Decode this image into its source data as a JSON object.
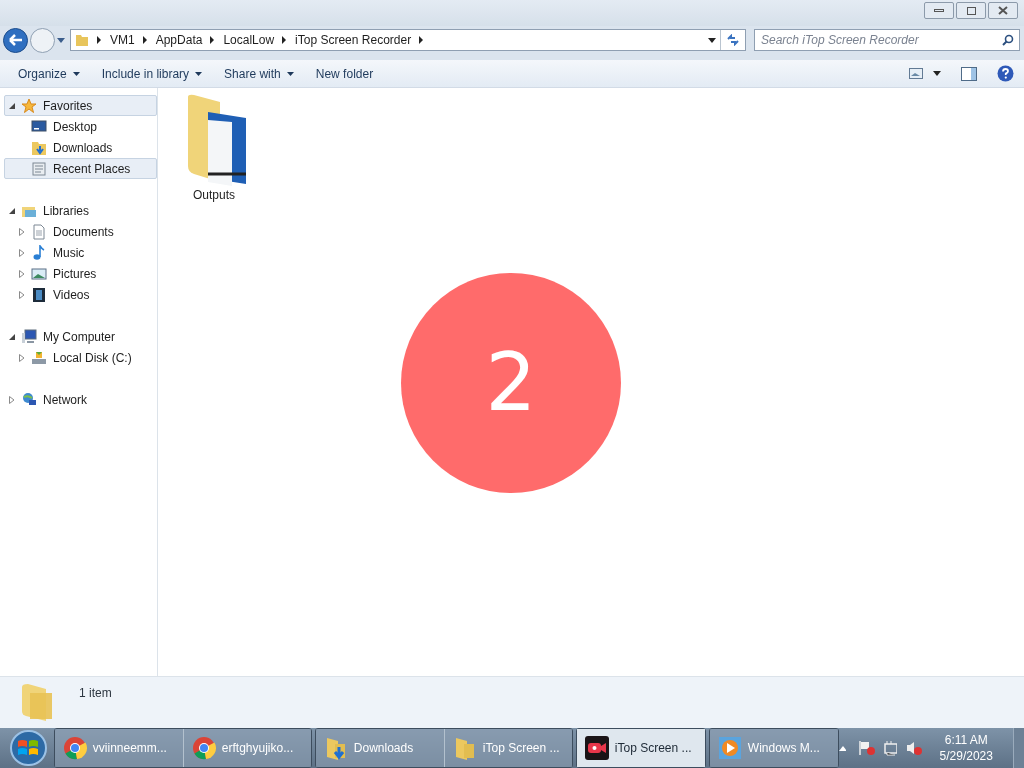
{
  "address": {
    "crumbs": [
      "VM1",
      "AppData",
      "LocalLow",
      "iTop Screen Recorder"
    ]
  },
  "search": {
    "placeholder": "Search iTop Screen Recorder"
  },
  "toolbar": {
    "menus": [
      {
        "label": "Organize",
        "dropdown": true
      },
      {
        "label": "Include in library",
        "dropdown": true
      },
      {
        "label": "Share with",
        "dropdown": true
      },
      {
        "label": "New folder",
        "dropdown": false
      }
    ]
  },
  "sidebar": {
    "groups": [
      {
        "label": "Favorites",
        "kind": "star",
        "expanded": true,
        "highlighted": true,
        "children": [
          {
            "label": "Desktop",
            "kind": "desktop",
            "highlighted": false
          },
          {
            "label": "Downloads",
            "kind": "downloads",
            "highlighted": false
          },
          {
            "label": "Recent Places",
            "kind": "recent",
            "highlighted": true
          }
        ]
      },
      {
        "label": "Libraries",
        "kind": "library",
        "expanded": true,
        "highlighted": false,
        "children": [
          {
            "label": "Documents",
            "kind": "documents",
            "expanded": false,
            "highlighted": false
          },
          {
            "label": "Music",
            "kind": "music",
            "expanded": false,
            "highlighted": false
          },
          {
            "label": "Pictures",
            "kind": "pictures",
            "expanded": false,
            "highlighted": false
          },
          {
            "label": "Videos",
            "kind": "videos",
            "expanded": false,
            "highlighted": false
          }
        ]
      },
      {
        "label": "My Computer",
        "kind": "computer",
        "expanded": true,
        "highlighted": false,
        "children": [
          {
            "label": "Local Disk (C:)",
            "kind": "disk",
            "expanded": false,
            "highlighted": false
          }
        ]
      },
      {
        "label": "Network",
        "kind": "network",
        "expanded": false,
        "highlighted": false
      }
    ]
  },
  "files": [
    {
      "name": "Outputs"
    }
  ],
  "countdown": "2",
  "status_bar": {
    "text": "1 item"
  },
  "taskbar": {
    "groups": [
      [
        {
          "label": "vviinneemm...",
          "kind": "chrome",
          "selected": false
        },
        {
          "label": "erftghyujiko...",
          "kind": "chrome",
          "selected": false
        }
      ],
      [
        {
          "label": "Downloads",
          "kind": "downloads",
          "selected": false
        },
        {
          "label": "iTop Screen ...",
          "kind": "folder",
          "selected": false
        }
      ],
      [
        {
          "label": "iTop Screen ...",
          "kind": "itop",
          "selected": true
        }
      ],
      [
        {
          "label": "Windows M...",
          "kind": "media",
          "selected": false
        }
      ]
    ],
    "clock": {
      "time": "6:11 AM",
      "date": "5/29/2023"
    }
  }
}
